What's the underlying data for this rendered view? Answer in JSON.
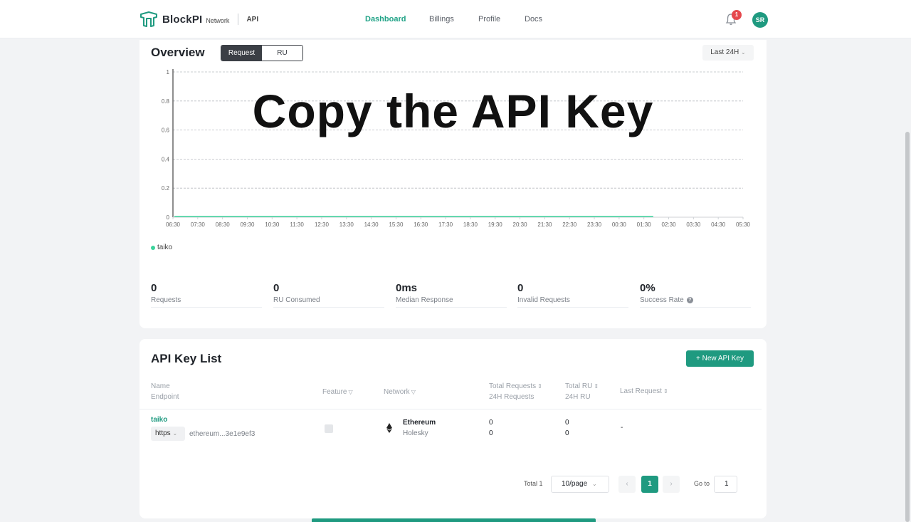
{
  "header": {
    "brand": "BlockPI",
    "brand_sub": "Network",
    "brand_section": "API",
    "nav": [
      {
        "label": "Dashboard",
        "active": true
      },
      {
        "label": "Billings",
        "active": false
      },
      {
        "label": "Profile",
        "active": false
      },
      {
        "label": "Docs",
        "active": false
      }
    ],
    "notification_count": "1",
    "avatar_initials": "SR"
  },
  "overview": {
    "title": "Overview",
    "toggle": [
      "Request",
      "RU"
    ],
    "range": "Last 24H",
    "overlay_text": "Copy the API Key",
    "legend": "taiko",
    "stats": [
      {
        "value": "0",
        "label": "Requests"
      },
      {
        "value": "0",
        "label": "RU Consumed"
      },
      {
        "value": "0ms",
        "label": "Median Response"
      },
      {
        "value": "0",
        "label": "Invalid Requests"
      },
      {
        "value": "0%",
        "label": "Success Rate"
      }
    ]
  },
  "chart_data": {
    "type": "line",
    "x": [
      "06:30",
      "07:30",
      "08:30",
      "09:30",
      "10:30",
      "11:30",
      "12:30",
      "13:30",
      "14:30",
      "15:30",
      "16:30",
      "17:30",
      "18:30",
      "19:30",
      "20:30",
      "21:30",
      "22:30",
      "23:30",
      "00:30",
      "01:30",
      "02:30",
      "03:30",
      "04:30",
      "05:30"
    ],
    "y_ticks": [
      "0",
      "0.2",
      "0.4",
      "0.6",
      "0.8",
      "1"
    ],
    "ylim": [
      0,
      1
    ],
    "grid": true,
    "series": [
      {
        "name": "taiko",
        "color": "#3bd39b",
        "values": [
          0,
          0,
          0,
          0,
          0,
          0,
          0,
          0,
          0,
          0,
          0,
          0,
          0,
          0,
          0,
          0,
          0,
          0,
          0,
          0
        ]
      }
    ]
  },
  "api_keys": {
    "title": "API Key List",
    "new_button": "+ New API Key",
    "headers": {
      "name": "Name",
      "endpoint": "Endpoint",
      "feature": "Feature",
      "network": "Network",
      "total_requests": "Total Requests",
      "requests_24h": "24H Requests",
      "total_ru": "Total RU",
      "ru_24h": "24H RU",
      "last_request": "Last Request"
    },
    "rows": [
      {
        "name": "taiko",
        "protocol": "https",
        "endpoint": "ethereum...3e1e9ef3",
        "network": "Ethereum",
        "network_sub": "Holesky",
        "total_requests": "0",
        "requests_24h": "0",
        "total_ru": "0",
        "ru_24h": "0",
        "last_request": "-"
      }
    ],
    "pagination": {
      "total": "Total 1",
      "page_size": "10/page",
      "current": "1",
      "goto_label": "Go to",
      "goto_value": "1"
    }
  },
  "colors": {
    "accent": "#1f9a80",
    "series": "#3bd39b",
    "badge": "#e5484d"
  }
}
